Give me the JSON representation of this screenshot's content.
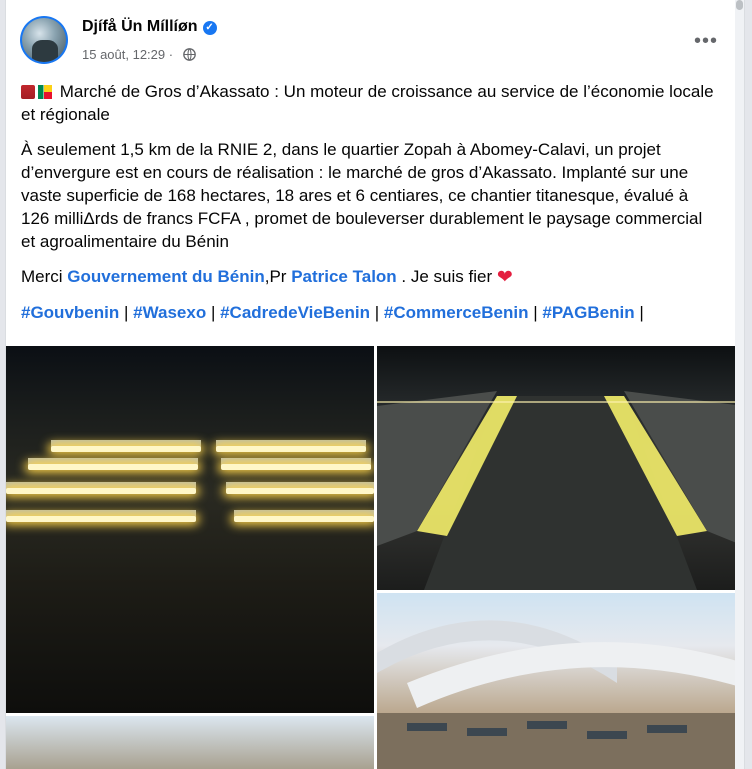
{
  "post": {
    "author": "Djífå Ün Míllíøn",
    "date": "15 août, 12:29",
    "audience_separator": "·",
    "more_label": "•••",
    "title": "Marché de Gros d’Akassato : Un moteur de croissance au service de l’économie locale et régionale",
    "paragraph": "À seulement 1,5 km de la RNIE 2, dans le quartier Zopah à Abomey-Calavi, un projet d’envergure est en cours de réalisation : le marché de gros d’Akassato. Implanté sur une vaste superficie de 168 hectares, 18 ares et 6 centiares, ce chantier titanesque, évalué à 126 milliΔrds de francs FCFA , promet de bouleverser durablement le paysage commercial et agroalimentaire du Bénin",
    "thanks_prefix": "Merci",
    "thanks_link1": "Gouvernement du Bénin",
    "thanks_mid": ",Pr",
    "thanks_link2": "Patrice Talon",
    "thanks_suffix": ". Je suis fier",
    "heart": "❤",
    "hashtags": [
      "#Gouvbenin",
      "#Wasexo",
      "#CadredeVieBenin",
      "#CommerceBenin",
      "#PAGBenin"
    ],
    "hashtag_separator": "|"
  },
  "icons": {
    "verified": "verified-badge-icon",
    "globe": "globe-icon",
    "more": "more-options-icon"
  },
  "colors": {
    "link": "#216fdb",
    "verified": "#1877f2",
    "heart": "#e41e3f",
    "meta": "#65676b"
  }
}
